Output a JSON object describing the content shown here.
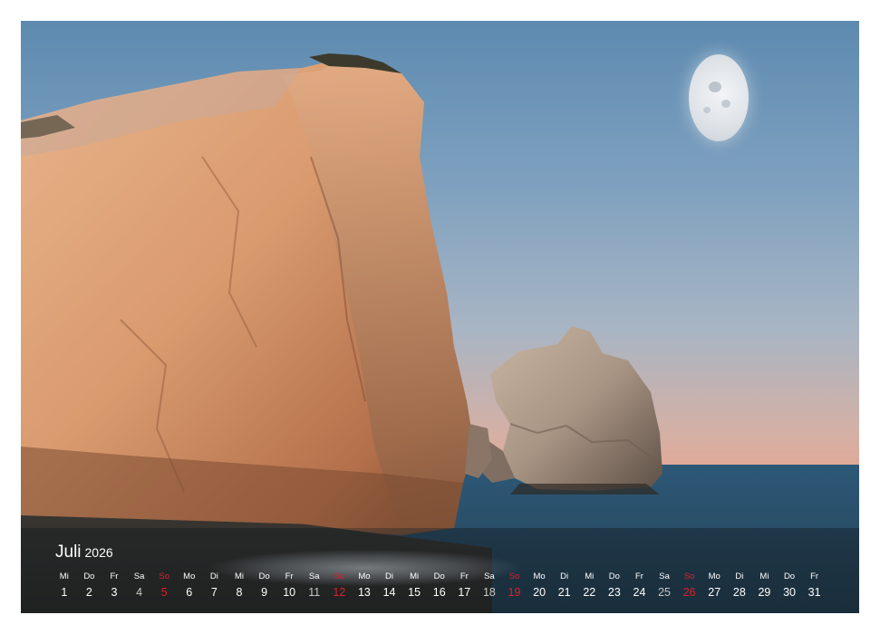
{
  "calendar": {
    "month": "Juli",
    "year": "2026",
    "days": [
      {
        "dow": "Mi",
        "num": "1",
        "type": "weekday"
      },
      {
        "dow": "Do",
        "num": "2",
        "type": "weekday"
      },
      {
        "dow": "Fr",
        "num": "3",
        "type": "weekday"
      },
      {
        "dow": "Sa",
        "num": "4",
        "type": "sat"
      },
      {
        "dow": "So",
        "num": "5",
        "type": "sun"
      },
      {
        "dow": "Mo",
        "num": "6",
        "type": "weekday"
      },
      {
        "dow": "Di",
        "num": "7",
        "type": "weekday"
      },
      {
        "dow": "Mi",
        "num": "8",
        "type": "weekday"
      },
      {
        "dow": "Do",
        "num": "9",
        "type": "weekday"
      },
      {
        "dow": "Fr",
        "num": "10",
        "type": "weekday"
      },
      {
        "dow": "Sa",
        "num": "11",
        "type": "sat"
      },
      {
        "dow": "So",
        "num": "12",
        "type": "sun"
      },
      {
        "dow": "Mo",
        "num": "13",
        "type": "weekday"
      },
      {
        "dow": "Di",
        "num": "14",
        "type": "weekday"
      },
      {
        "dow": "Mi",
        "num": "15",
        "type": "weekday"
      },
      {
        "dow": "Do",
        "num": "16",
        "type": "weekday"
      },
      {
        "dow": "Fr",
        "num": "17",
        "type": "weekday"
      },
      {
        "dow": "Sa",
        "num": "18",
        "type": "sat"
      },
      {
        "dow": "So",
        "num": "19",
        "type": "sun"
      },
      {
        "dow": "Mo",
        "num": "20",
        "type": "weekday"
      },
      {
        "dow": "Di",
        "num": "21",
        "type": "weekday"
      },
      {
        "dow": "Mi",
        "num": "22",
        "type": "weekday"
      },
      {
        "dow": "Do",
        "num": "23",
        "type": "weekday"
      },
      {
        "dow": "Fr",
        "num": "24",
        "type": "weekday"
      },
      {
        "dow": "Sa",
        "num": "25",
        "type": "sat"
      },
      {
        "dow": "So",
        "num": "26",
        "type": "sun"
      },
      {
        "dow": "Mo",
        "num": "27",
        "type": "weekday"
      },
      {
        "dow": "Di",
        "num": "28",
        "type": "weekday"
      },
      {
        "dow": "Mi",
        "num": "29",
        "type": "weekday"
      },
      {
        "dow": "Do",
        "num": "30",
        "type": "weekday"
      },
      {
        "dow": "Fr",
        "num": "31",
        "type": "weekday"
      }
    ]
  },
  "colors": {
    "sunday": "#d9212a",
    "text": "#ffffff",
    "saturday_number": "#c8c8c8"
  },
  "photo": {
    "elements": [
      "sea-cliff",
      "sea-stack-rock",
      "moon",
      "sea",
      "pebble-shore"
    ]
  }
}
